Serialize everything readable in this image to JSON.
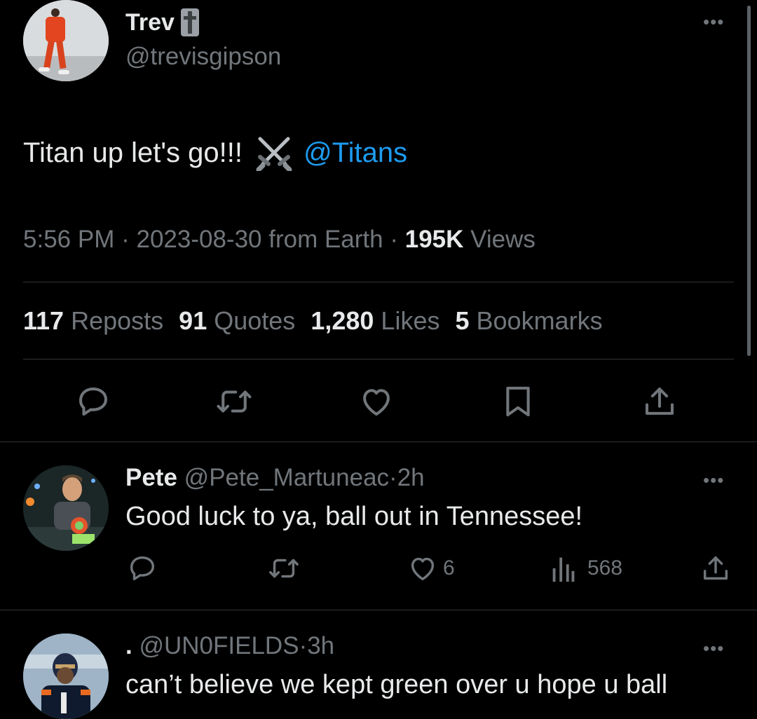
{
  "tweet": {
    "author_name": "Trev",
    "author_handle": "@trevisgipson",
    "text": "Titan up let's go!!! ",
    "emoji": "⚔️",
    "mention": "@Titans",
    "time": "5:56 PM",
    "date": "2023-08-30 from Earth",
    "views_count": "195K",
    "views_label": "Views",
    "stats": [
      {
        "count": "117",
        "label": "Reposts"
      },
      {
        "count": "91",
        "label": "Quotes"
      },
      {
        "count": "1,280",
        "label": "Likes"
      },
      {
        "count": "5",
        "label": "Bookmarks"
      }
    ]
  },
  "replies": [
    {
      "name": "Pete",
      "handle": "@Pete_Martuneac",
      "age": "2h",
      "text": "Good luck to ya, ball out in Tennessee!",
      "likes": "6",
      "views": "568"
    },
    {
      "name": ".",
      "handle": "@UN0FIELDS",
      "age": "3h",
      "text": "can’t believe we kept green over u hope u ball"
    }
  ],
  "separator": "·",
  "colors": {
    "background": "#000000",
    "text": "#e7e9ea",
    "muted": "#71767b",
    "link": "#1d9bf0",
    "divider": "#2f3336"
  }
}
